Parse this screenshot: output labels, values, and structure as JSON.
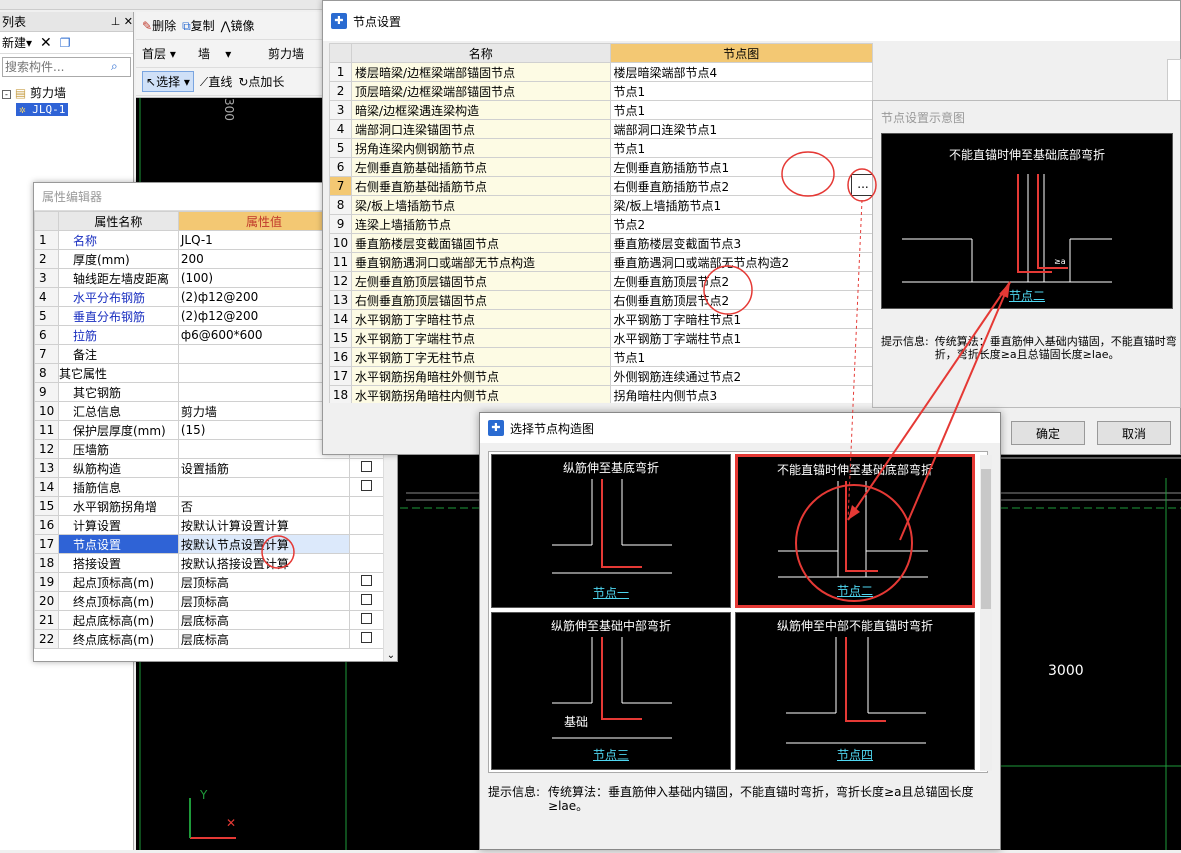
{
  "left_panel": {
    "title": "列表",
    "new_label": "新建",
    "search_placeholder": "搜索构件...",
    "tree_root": "剪力墙",
    "tree_child": "JLQ-1"
  },
  "cad_toolbar": {
    "delete": "删除",
    "copy": "复制",
    "mirror": "镜像",
    "floor": "首层",
    "type": "墙",
    "subtype": "剪力墙",
    "select": "选择",
    "line": "直线",
    "point_add": "点加长"
  },
  "canvas": {
    "dimension_3000": "3000",
    "dimension_300": "300",
    "axis_y": "Y"
  },
  "prop_editor": {
    "title": "属性编辑器",
    "col_name": "属性名称",
    "col_value": "属性值",
    "rows": [
      {
        "n": "1",
        "name": "名称",
        "value": "JLQ-1",
        "blue": true
      },
      {
        "n": "2",
        "name": "厚度(mm)",
        "value": "200"
      },
      {
        "n": "3",
        "name": "轴线距左墙皮距离",
        "value": "(100)"
      },
      {
        "n": "4",
        "name": "水平分布钢筋",
        "value": "(2)ф12@200",
        "blue": true
      },
      {
        "n": "5",
        "name": "垂直分布钢筋",
        "value": "(2)ф12@200",
        "blue": true
      },
      {
        "n": "6",
        "name": "拉筋",
        "value": "ф6@600*600",
        "blue": true
      },
      {
        "n": "7",
        "name": "备注",
        "value": ""
      },
      {
        "n": "8",
        "name": "其它属性",
        "value": "",
        "group": true
      },
      {
        "n": "9",
        "name": "其它钢筋",
        "value": ""
      },
      {
        "n": "10",
        "name": "汇总信息",
        "value": "剪力墙"
      },
      {
        "n": "11",
        "name": "保护层厚度(mm)",
        "value": "(15)"
      },
      {
        "n": "12",
        "name": "压墙筋",
        "value": ""
      },
      {
        "n": "13",
        "name": "纵筋构造",
        "value": "设置插筋",
        "cb": true
      },
      {
        "n": "14",
        "name": "插筋信息",
        "value": "",
        "cb": true
      },
      {
        "n": "15",
        "name": "水平钢筋拐角增",
        "value": "否"
      },
      {
        "n": "16",
        "name": "计算设置",
        "value": "按默认计算设置计算"
      },
      {
        "n": "17",
        "name": "节点设置",
        "value": "按默认节点设置计算",
        "selected": true
      },
      {
        "n": "18",
        "name": "搭接设置",
        "value": "按默认搭接设置计算"
      },
      {
        "n": "19",
        "name": "起点顶标高(m)",
        "value": "层顶标高",
        "cb": true
      },
      {
        "n": "20",
        "name": "终点顶标高(m)",
        "value": "层顶标高",
        "cb": true
      },
      {
        "n": "21",
        "name": "起点底标高(m)",
        "value": "层底标高",
        "cb": true
      },
      {
        "n": "22",
        "name": "终点底标高(m)",
        "value": "层底标高",
        "cb": true
      }
    ]
  },
  "node_settings": {
    "title": "节点设置",
    "col_name": "名称",
    "col_diagram": "节点图",
    "rows": [
      {
        "n": "1",
        "name": "楼层暗梁/边框梁端部锚固节点",
        "diagram": "楼层暗梁端部节点4"
      },
      {
        "n": "2",
        "name": "顶层暗梁/边框梁端部锚固节点",
        "diagram": "节点1"
      },
      {
        "n": "3",
        "name": "暗梁/边框梁遇连梁构造",
        "diagram": "节点1"
      },
      {
        "n": "4",
        "name": "端部洞口连梁锚固节点",
        "diagram": "端部洞口连梁节点1"
      },
      {
        "n": "5",
        "name": "拐角连梁内侧钢筋节点",
        "diagram": "节点1"
      },
      {
        "n": "6",
        "name": "左侧垂直筋基础插筋节点",
        "diagram": "左侧垂直筋插筋节点1"
      },
      {
        "n": "7",
        "name": "右侧垂直筋基础插筋节点",
        "diagram": "右侧垂直筋插筋节点2",
        "selected": true
      },
      {
        "n": "8",
        "name": "梁/板上墙插筋节点",
        "diagram": "梁/板上墙插筋节点1"
      },
      {
        "n": "9",
        "name": "连梁上墙插筋节点",
        "diagram": "节点2"
      },
      {
        "n": "10",
        "name": "垂直筋楼层变截面锚固节点",
        "diagram": "垂直筋楼层变截面节点3"
      },
      {
        "n": "11",
        "name": "垂直钢筋遇洞口或端部无节点构造",
        "diagram": "垂直筋遇洞口或端部无节点构造2"
      },
      {
        "n": "12",
        "name": "左侧垂直筋顶层锚固节点",
        "diagram": "左侧垂直筋顶层节点2"
      },
      {
        "n": "13",
        "name": "右侧垂直筋顶层锚固节点",
        "diagram": "右侧垂直筋顶层节点2"
      },
      {
        "n": "14",
        "name": "水平钢筋丁字暗柱节点",
        "diagram": "水平钢筋丁字暗柱节点1"
      },
      {
        "n": "15",
        "name": "水平钢筋丁字端柱节点",
        "diagram": "水平钢筋丁字端柱节点1"
      },
      {
        "n": "16",
        "name": "水平钢筋丁字无柱节点",
        "diagram": "节点1"
      },
      {
        "n": "17",
        "name": "水平钢筋拐角暗柱外侧节点",
        "diagram": "外侧钢筋连续通过节点2"
      },
      {
        "n": "18",
        "name": "水平钢筋拐角暗柱内侧节点",
        "diagram": "拐角暗柱内侧节点3"
      }
    ],
    "ellipsis": "...",
    "ok": "确定",
    "cancel": "取消"
  },
  "preview": {
    "title": "节点设置示意图",
    "caption": "不能直锚时伸至基础底部弯折",
    "node_label": "节点二",
    "hint_label": "提示信息:",
    "hint_text": "传统算法：垂直筋伸入基础内锚固，不能直锚时弯折，弯折长度≥a且总锚固长度≥lae。"
  },
  "select_dialog": {
    "title": "选择节点构造图",
    "tiles": [
      {
        "caption": "纵筋伸至基底弯折",
        "label": "节点一"
      },
      {
        "caption": "不能直锚时伸至基础底部弯折",
        "label": "节点二",
        "selected": true
      },
      {
        "caption": "纵筋伸至基础中部弯折",
        "label": "节点三",
        "extra": "基础"
      },
      {
        "caption": "纵筋伸至中部不能直锚时弯折",
        "label": "节点四"
      }
    ],
    "hint_label": "提示信息:",
    "hint_text": "传统算法：垂直筋伸入基础内锚固，不能直锚时弯折，弯折长度≥a且总锚固长度≥lae。"
  },
  "colors": {
    "highlight_header": "#f3c873",
    "annotation_red": "#e53935",
    "link_cyan": "#4fd6f0"
  }
}
